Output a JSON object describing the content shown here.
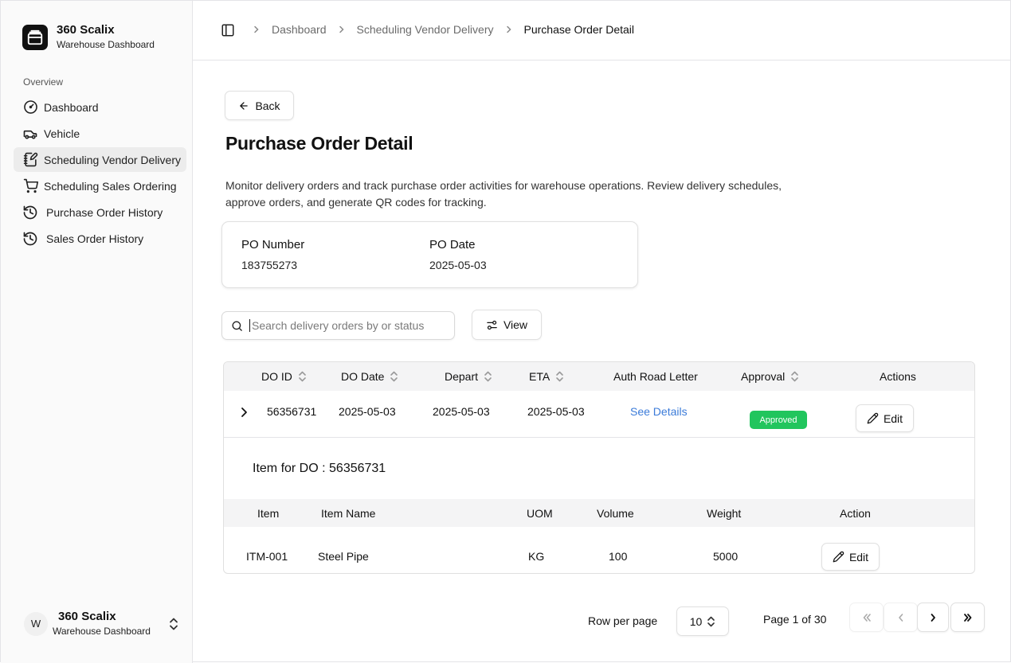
{
  "brand": {
    "title": "360 Scalix",
    "subtitle": "Warehouse Dashboard"
  },
  "sidebar": {
    "section_label": "Overview",
    "items": [
      {
        "label": "Dashboard",
        "icon": "gauge-icon"
      },
      {
        "label": "Vehicle",
        "icon": "truck-icon"
      },
      {
        "label": "Scheduling Vendor Delivery",
        "icon": "notebook-pen-icon",
        "active": true
      },
      {
        "label": "Scheduling Sales Ordering",
        "icon": "shopping-cart-icon"
      },
      {
        "label": "Purchase Order History",
        "icon": "history-icon"
      },
      {
        "label": "Sales Order History",
        "icon": "history-icon"
      }
    ]
  },
  "user": {
    "initial": "W",
    "title": "360 Scalix",
    "subtitle": "Warehouse Dashboard"
  },
  "breadcrumb": {
    "items": [
      "Dashboard",
      "Scheduling Vendor Delivery",
      "Purchase Order Detail"
    ]
  },
  "main": {
    "back_label": "Back",
    "title": "Purchase Order Detail",
    "description": "Monitor delivery orders and track purchase order activities for warehouse operations. Review delivery schedules, approve orders, and generate QR codes for tracking."
  },
  "po": {
    "number_label": "PO Number",
    "number_value": "183755273",
    "date_label": "PO Date",
    "date_value": "2025-05-03"
  },
  "search": {
    "placeholder": "Search delivery orders by or status",
    "value": ""
  },
  "view_label": "View",
  "table": {
    "headers": [
      "DO ID",
      "DO Date",
      "Depart",
      "ETA",
      "Auth Road Letter",
      "Approval",
      "Actions"
    ],
    "rows": [
      {
        "do_id": "56356731",
        "do_date": "2025-05-03",
        "depart": "2025-05-03",
        "eta": "2025-05-03",
        "auth_road_letter": "See Details",
        "approval": "Approved",
        "action": "Edit"
      }
    ],
    "expanded": {
      "title": "Item for DO : 56356731",
      "headers": [
        "Item",
        "Item Name",
        "UOM",
        "Volume",
        "Weight",
        "Action"
      ],
      "rows": [
        {
          "item": "ITM-001",
          "item_name": "Steel Pipe",
          "uom": "KG",
          "volume": "100",
          "weight": "5000",
          "action": "Edit"
        }
      ]
    }
  },
  "pagination": {
    "rows_per_page_label": "Row per page",
    "rows_per_page": "10",
    "page_info": "Page 1 of 30"
  },
  "colors": {
    "approved": "#21c55d",
    "link": "#3b7bd9"
  }
}
